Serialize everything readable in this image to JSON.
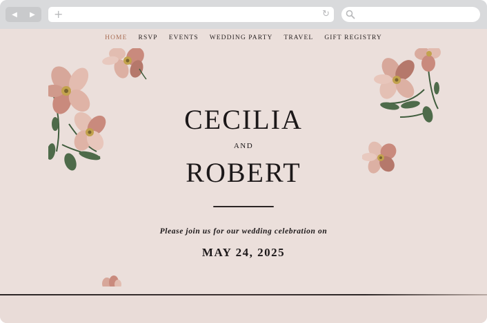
{
  "browser": {
    "back_icon": "◀",
    "forward_icon": "▶",
    "new_tab_icon": "+",
    "reload_icon": "↻"
  },
  "nav": {
    "items": [
      "HOME",
      "RSVP",
      "EVENTS",
      "WEDDING PARTY",
      "TRAVEL",
      "GIFT REGISTRY"
    ],
    "active": "HOME"
  },
  "couple": {
    "name1": "CECILIA",
    "and": "AND",
    "name2": "ROBERT"
  },
  "invite_text": "Please join us for our wedding celebration on",
  "date": "MAY 24, 2025",
  "colors": {
    "background": "#ebdfdb",
    "accent": "#a96e55",
    "text": "#1c1819",
    "petal": "#d7a79a",
    "leaf": "#4e6b4a"
  }
}
